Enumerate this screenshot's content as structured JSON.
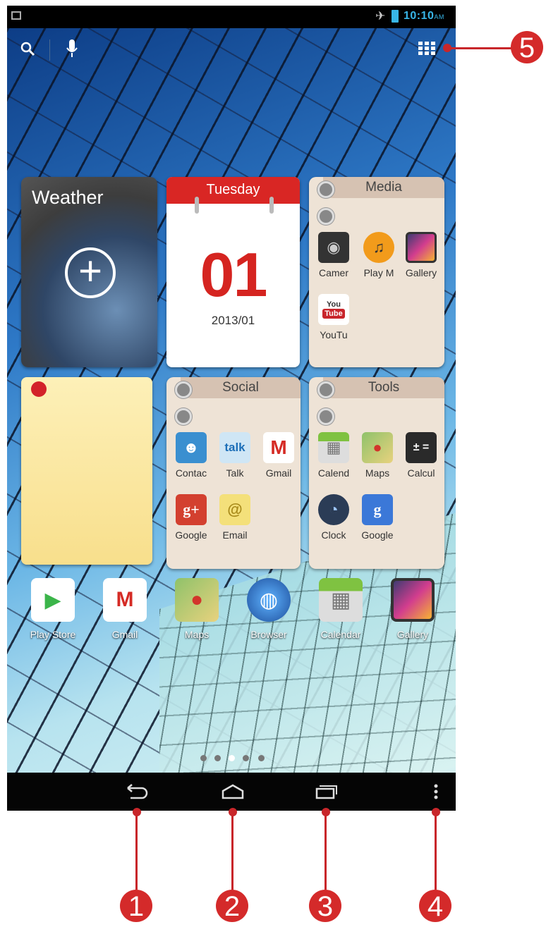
{
  "status_bar": {
    "time": "10:10",
    "ampm": "AM"
  },
  "widgets": {
    "weather": {
      "title": "Weather"
    },
    "calendar": {
      "weekday": "Tuesday",
      "day": "01",
      "date": "2013/01"
    },
    "media": {
      "title": "Media",
      "apps": [
        "Camer",
        "Play M",
        "Gallery",
        "YouTu"
      ]
    },
    "social": {
      "title": "Social",
      "apps": [
        "Contac",
        "Talk",
        "Gmail",
        "Google",
        "Email"
      ]
    },
    "tools": {
      "title": "Tools",
      "apps": [
        "Calend",
        "Maps",
        "Calcul",
        "Clock",
        "Google"
      ]
    }
  },
  "icon_text": {
    "youtube_top": "You",
    "youtube_bottom": "Tube",
    "talk": "talk",
    "gplus": "g+",
    "google": "g"
  },
  "dock": {
    "apps": [
      "Play Store",
      "Gmail",
      "Maps",
      "Browser",
      "Calendar",
      "Gallery"
    ]
  },
  "callouts": [
    "1",
    "2",
    "3",
    "4",
    "5"
  ],
  "colors": {
    "accent_red": "#d42a2a",
    "status_blue": "#38b6e8",
    "calendar_red": "#d92624"
  }
}
